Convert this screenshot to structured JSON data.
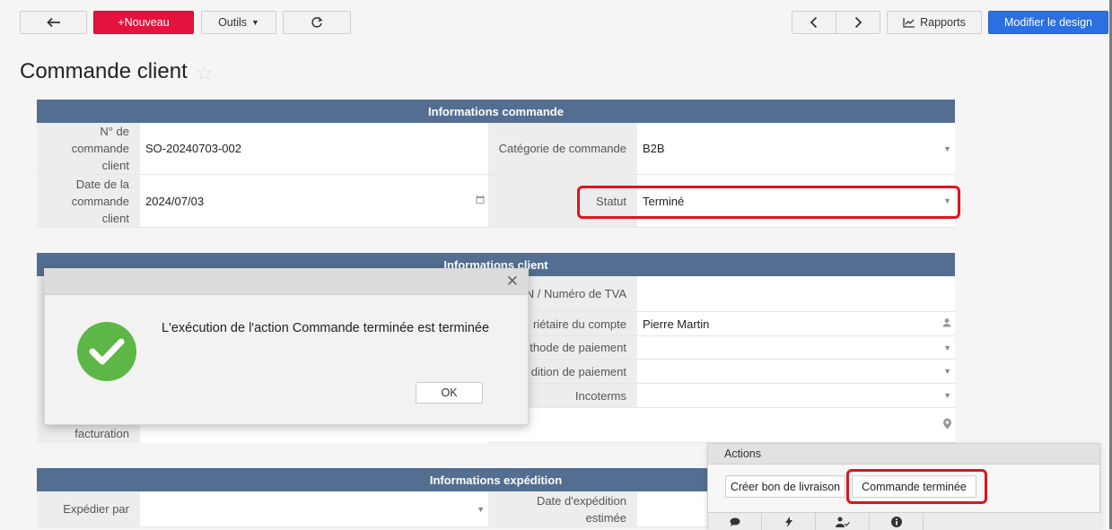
{
  "toolbar": {
    "new_label": "+Nouveau",
    "tools_label": "Outils",
    "reports_label": "Rapports",
    "modify_design_label": "Modifier le design"
  },
  "page": {
    "title": "Commande client"
  },
  "order_info": {
    "header": "Informations commande",
    "order_number_label": "N° de commande client",
    "order_number_value": "SO-20240703-002",
    "order_category_label": "Catégorie de commande",
    "order_category_value": "B2B",
    "order_date_label": "Date de la commande client",
    "order_date_value": "2024/07/03",
    "status_label": "Statut",
    "status_value": "Terminé"
  },
  "client_info": {
    "header": "Informations client",
    "ein_label": "ro EIN / Numéro de TVA",
    "owner_label": "riétaire du compte",
    "owner_value": "Pierre Martin",
    "payment_method_label": "thode de paiement",
    "payment_term_label": "dition de paiement",
    "incoterms_label": "Incoterms",
    "billing_label": "facturation"
  },
  "shipping_info": {
    "header": "Informations expédition",
    "ship_by_label": "Expédier par",
    "est_ship_date_label": "Date d'expédition estimée"
  },
  "dialog": {
    "message": "L'exécution de l'action Commande terminée est terminée",
    "ok_label": "OK"
  },
  "actions_panel": {
    "title": "Actions",
    "create_delivery_label": "Créer bon de livraison",
    "order_complete_label": "Commande terminée"
  },
  "colors": {
    "accent_red": "#e5123d",
    "accent_blue": "#2b6fe0",
    "section_header": "#536e91",
    "success_green": "#5cb746",
    "highlight_red": "#e0141d"
  }
}
